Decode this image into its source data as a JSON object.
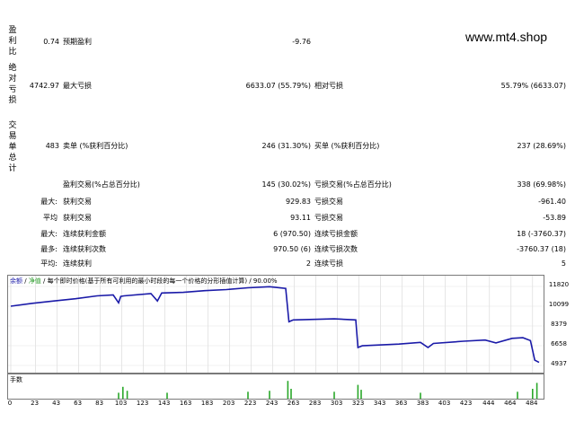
{
  "watermark": "www.mt4.shop",
  "side_labels": {
    "profit_factor": "盈利比",
    "absolute_drawdown": "绝对亏损",
    "total_trades": "交易单总计"
  },
  "rows": {
    "r1": {
      "v1": "0.74",
      "l1": "预期盈利",
      "v2": "-9.76"
    },
    "r2": {
      "v1": "4742.97",
      "l1": "最大亏损",
      "v2": "6633.07 (55.79%)",
      "l2": "相对亏损",
      "v3": "55.79% (6633.07)"
    },
    "r3": {
      "v1": "483",
      "l1": "卖单 (%获利百分比)",
      "v2": "246 (31.30%)",
      "l2": "买单 (%获利百分比)",
      "v3": "237 (28.69%)"
    },
    "r4": {
      "l1": "盈利交易(%占总百分比)",
      "v2": "145 (30.02%)",
      "l2": "亏损交易(%占总百分比)",
      "v3": "338 (69.98%)"
    },
    "r5": {
      "p": "最大:",
      "l1": "获利交易",
      "v2": "929.83",
      "l2": "亏损交易",
      "v3": "-961.40"
    },
    "r6": {
      "p": "平均",
      "l1": "获利交易",
      "v2": "93.11",
      "l2": "亏损交易",
      "v3": "-53.89"
    },
    "r7": {
      "p": "最大:",
      "l1": "连续获利金额",
      "v2": "6 (970.50)",
      "l2": "连续亏损金额",
      "v3": "18 (-3760.37)"
    },
    "r8": {
      "p": "最多:",
      "l1": "连续获利次数",
      "v2": "970.50 (6)",
      "l2": "连续亏损次数",
      "v3": "-3760.37 (18)"
    },
    "r9": {
      "p": "平均:",
      "l1": "连续获利",
      "v2": "2",
      "l2": "连续亏损",
      "v3": "5"
    }
  },
  "chart": {
    "header_balance": "余额",
    "header_sep1": " / ",
    "header_equity": "净值",
    "header_desc": " / 每个即时价格(基于所有可利用的最小时段的每一个价格的分形插值计算) / 90.00%",
    "volume_label": "手数",
    "balance_color": "#1a1aa8",
    "equity_color": "#2a9a2a",
    "volume_color": "#2aa82a"
  },
  "chart_data": {
    "type": "line",
    "y_ticks": [
      "11820",
      "10099",
      "8379",
      "6658",
      "4937"
    ],
    "x_ticks": [
      "0",
      "23",
      "43",
      "63",
      "83",
      "103",
      "123",
      "143",
      "163",
      "183",
      "203",
      "223",
      "243",
      "263",
      "283",
      "303",
      "323",
      "343",
      "363",
      "383",
      "403",
      "423",
      "444",
      "464",
      "484"
    ],
    "ylim": [
      4937,
      11820
    ],
    "xlim": [
      0,
      490
    ],
    "series": [
      {
        "x": [
          0,
          20,
          40,
          60,
          80,
          95,
          100,
          102,
          105,
          130,
          136,
          140,
          160,
          180,
          200,
          220,
          240,
          255,
          258,
          262,
          300,
          320,
          322,
          326,
          360,
          380,
          387,
          392,
          420,
          440,
          450,
          465,
          475,
          482,
          486,
          490
        ],
        "y": [
          10100,
          10350,
          10550,
          10750,
          11000,
          11080,
          10400,
          10950,
          11000,
          11200,
          10550,
          11250,
          11300,
          11450,
          11550,
          11700,
          11800,
          11650,
          8750,
          8900,
          9000,
          8900,
          6500,
          6650,
          6800,
          6950,
          6500,
          6850,
          7050,
          7150,
          6900,
          7300,
          7350,
          7100,
          5400,
          5200
        ]
      }
    ],
    "volume": {
      "x": [
        100,
        104,
        108,
        145,
        220,
        240,
        257,
        260,
        300,
        322,
        325,
        380,
        470,
        484,
        488
      ],
      "values": [
        0.3,
        0.6,
        0.4,
        0.3,
        0.35,
        0.4,
        0.9,
        0.5,
        0.35,
        0.7,
        0.45,
        0.3,
        0.35,
        0.5,
        0.8
      ]
    }
  }
}
